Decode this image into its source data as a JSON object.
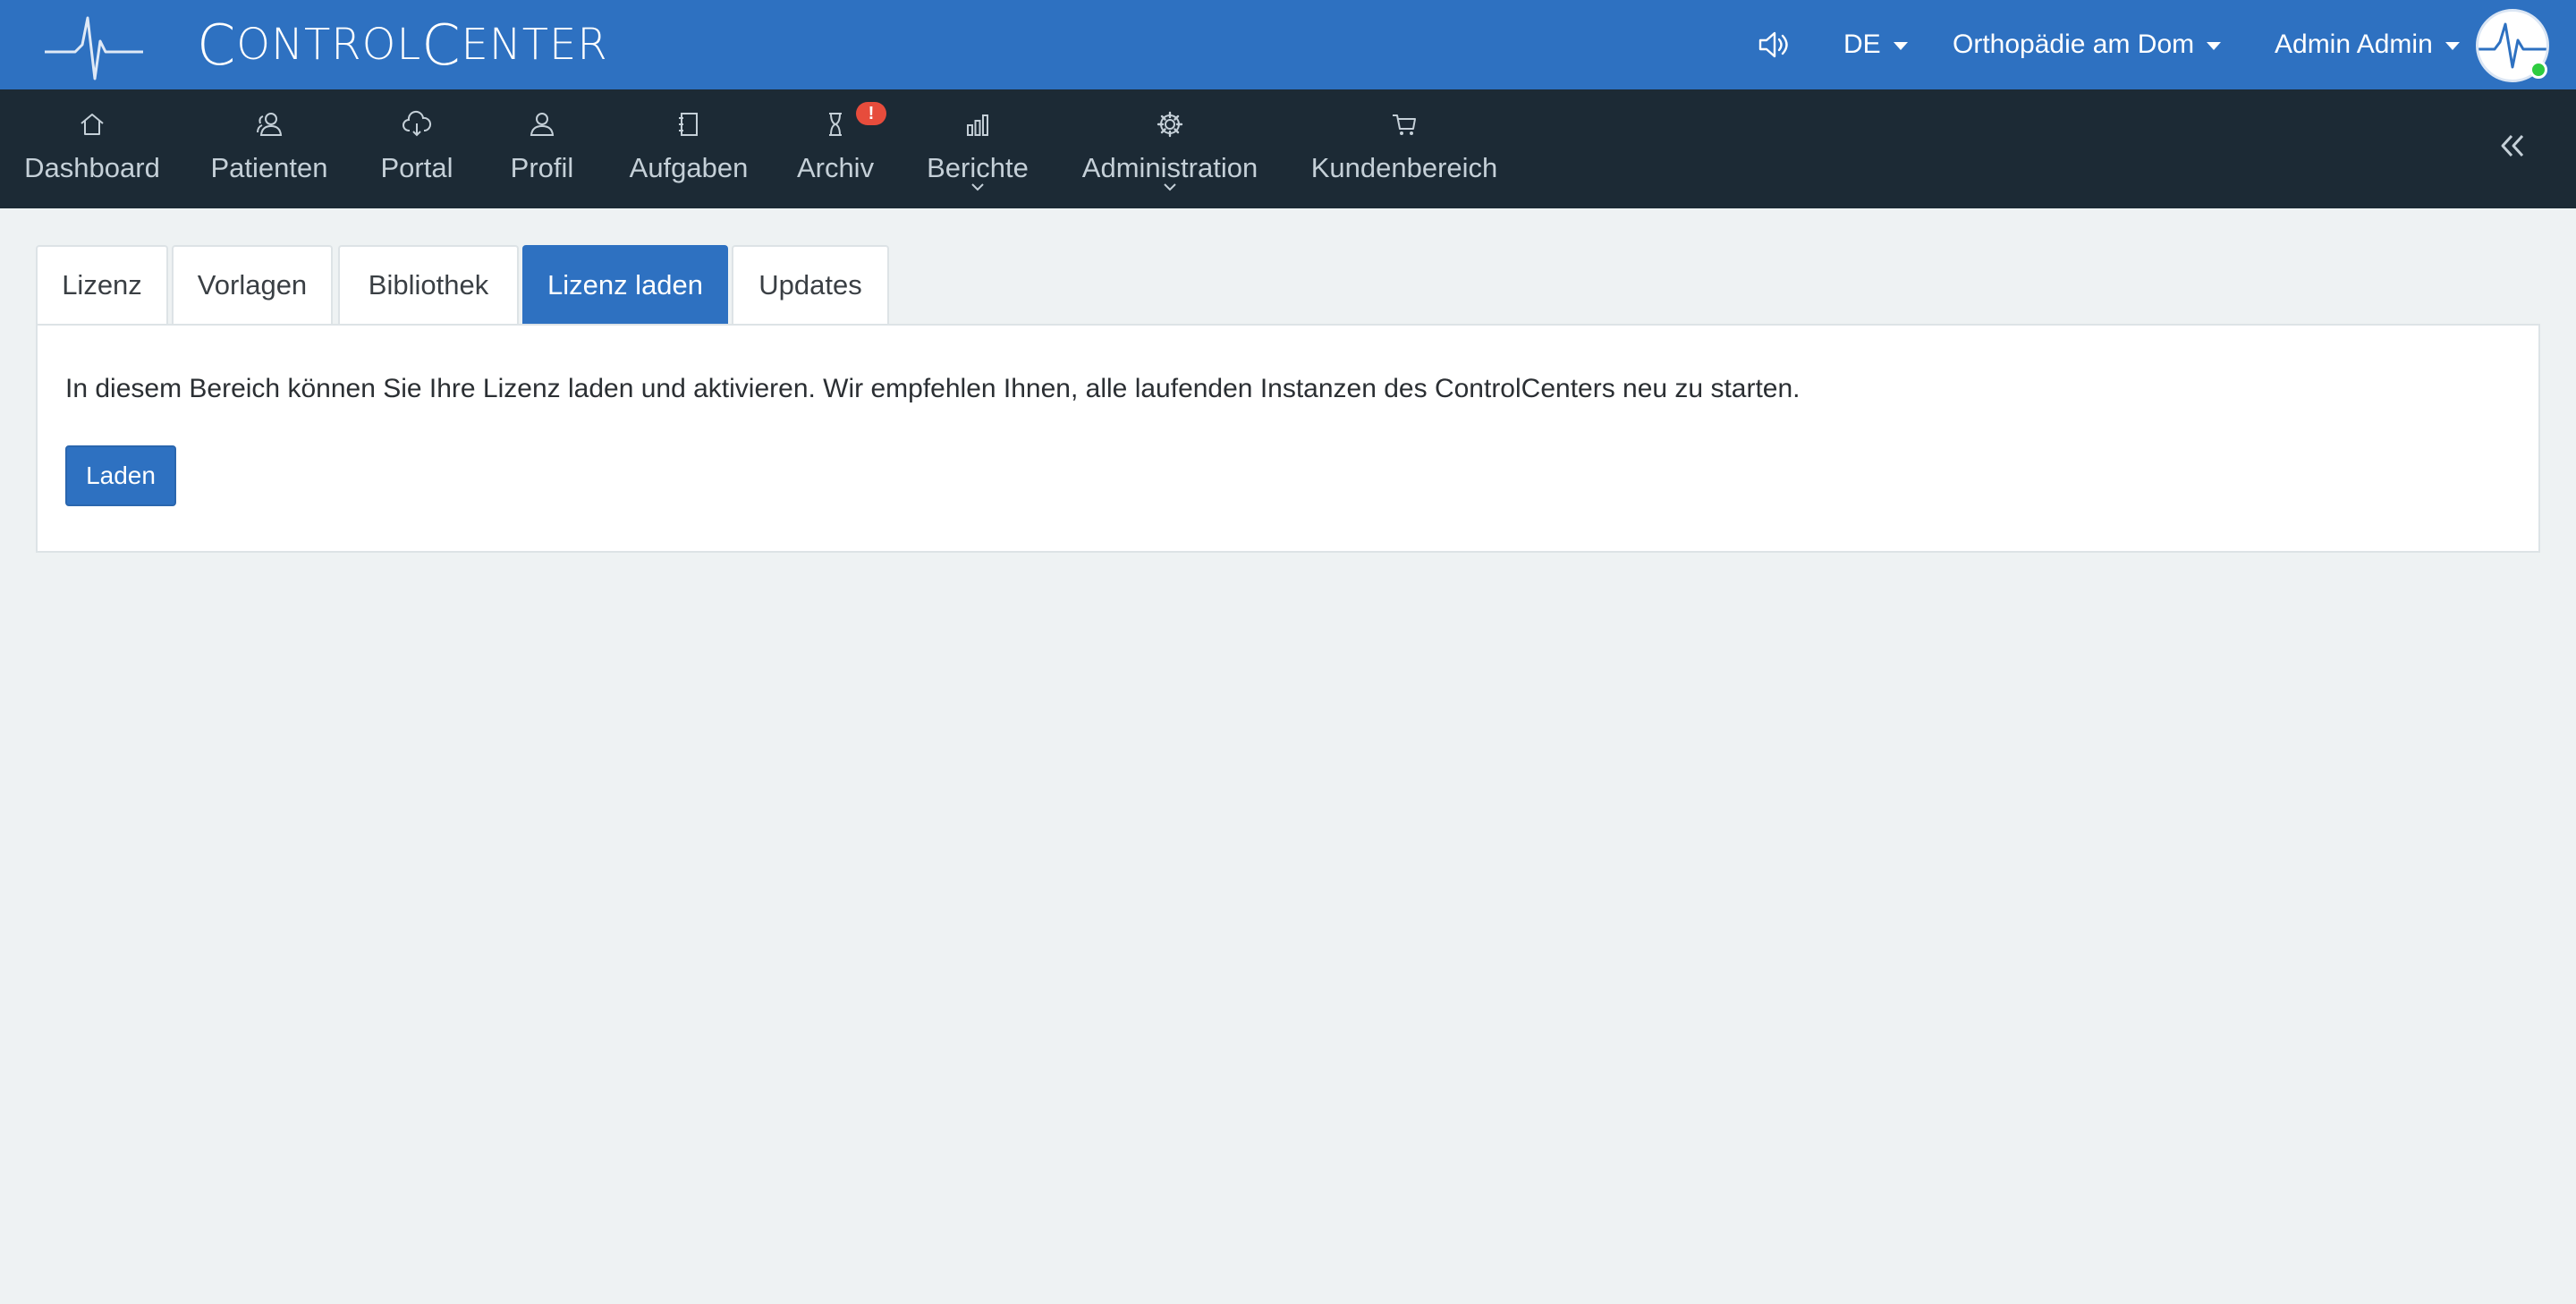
{
  "app": {
    "brand_first_initial": "C",
    "brand_first_rest": "ONTROL",
    "brand_second_initial": "C",
    "brand_second_rest": "ENTER"
  },
  "header": {
    "language": "DE",
    "practice": "Orthopädie am Dom",
    "user": "Admin Admin"
  },
  "nav": {
    "items": [
      {
        "label": "Dashboard",
        "icon": "home-icon"
      },
      {
        "label": "Patienten",
        "icon": "user-group-icon"
      },
      {
        "label": "Portal",
        "icon": "cloud-download-icon"
      },
      {
        "label": "Profil",
        "icon": "user-icon"
      },
      {
        "label": "Aufgaben",
        "icon": "notebook-icon"
      },
      {
        "label": "Archiv",
        "icon": "hourglass-icon",
        "badge": "!"
      },
      {
        "label": "Berichte",
        "icon": "bar-chart-icon"
      },
      {
        "label": "Administration",
        "icon": "gear-icon"
      },
      {
        "label": "Kundenbereich",
        "icon": "cart-icon"
      }
    ]
  },
  "tabs": [
    {
      "label": "Lizenz"
    },
    {
      "label": "Vorlagen"
    },
    {
      "label": "Bibliothek"
    },
    {
      "label": "Lizenz laden",
      "active": true
    },
    {
      "label": "Updates"
    }
  ],
  "panel": {
    "text": "In diesem Bereich können Sie Ihre Lizenz laden und aktivieren. Wir empfehlen Ihnen, alle laufenden Instanzen des ControlCenters neu zu starten.",
    "button": "Laden"
  },
  "colors": {
    "header_bg": "#2e71c1",
    "nav_bg": "#1c2a35",
    "page_bg": "#eef2f3",
    "badge": "#e74c3c",
    "online": "#2ecc40"
  }
}
